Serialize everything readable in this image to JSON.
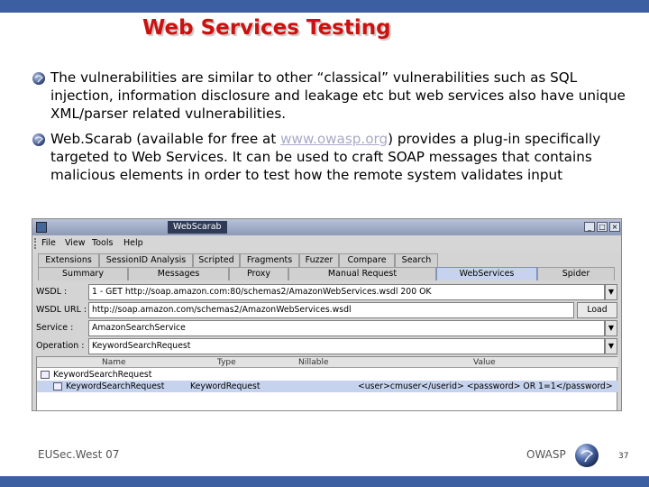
{
  "slide": {
    "title": "Web Services Testing",
    "bullets": [
      {
        "text": "The vulnerabilities are similar to other “classical” vulnerabilities such as SQL injection, information disclosure and leakage etc but web services also have unique XML/parser related vulnerabilities."
      },
      {
        "text_before": "Web.Scarab (available for free at ",
        "link": "www.owasp.org",
        "text_after": ") provides a plug-in specifically targeted to Web Services. It can be used to craft SOAP messages that contains malicious elements in order to test how the remote system validates input"
      }
    ],
    "footer_left": "EUSec.West 07",
    "footer_right": "OWASP",
    "page_number": "37"
  },
  "app": {
    "window_title": "WebScarab",
    "menu": [
      "File",
      "View",
      "Tools",
      "Help"
    ],
    "tabs_row1": [
      "Extensions",
      "SessionID Analysis",
      "Scripted",
      "Fragments",
      "Fuzzer",
      "Compare",
      "Search"
    ],
    "tabs_row2": [
      "Summary",
      "Messages",
      "Proxy",
      "Manual Request",
      "WebServices",
      "Spider"
    ],
    "active_tab": "WebServices",
    "wsdl_label": "WSDL :",
    "wsdl_value": "1 - GET http://soap.amazon.com:80/schemas2/AmazonWebServices.wsdl    200 OK",
    "wsdl_url_label": "WSDL URL :",
    "wsdl_url_value": "http://soap.amazon.com/schemas2/AmazonWebServices.wsdl",
    "load_label": "Load",
    "service_label": "Service :",
    "service_value": "AmazonSearchService",
    "operation_label": "Operation :",
    "operation_value": "KeywordSearchRequest",
    "table_headers": [
      "Name",
      "Type",
      "Nillable",
      "Value"
    ],
    "tree_root": "KeywordSearchRequest",
    "row": {
      "name": "KeywordSearchRequest",
      "type": "KeywordRequest",
      "value": "<user>cmuser</userid> <password> OR 1=1</password>"
    }
  },
  "colors": {
    "title_red": "#cc1111",
    "band_blue": "#3b5fa0",
    "selection_blue": "#c6d3ee"
  }
}
